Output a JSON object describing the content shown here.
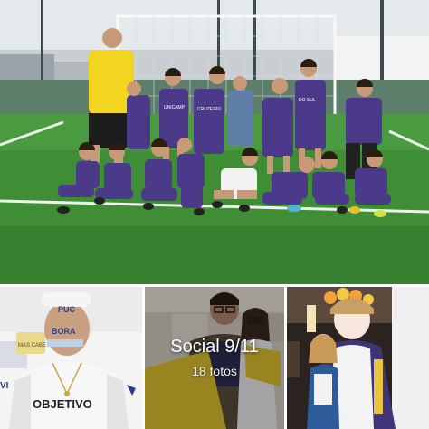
{
  "album": {
    "title": "Social 9/11",
    "count": "18 fotos"
  },
  "photos": {
    "main": {
      "shirt_text_1": "UNICAMP",
      "shirt_text_2": "CRUZEIRO",
      "shirt_text_3": "DO SUL"
    },
    "thumb1": {
      "hat_text": "PUC",
      "face_text": "BORA",
      "shirt_text": "OBJETIVO",
      "sign_text": "MAS CABE",
      "side_text": "VI"
    }
  },
  "colors": {
    "turf": "#3f8e36",
    "uniform": "#4b3a8a",
    "coach_shirt": "#f2d51e",
    "sky": "#e7ecee",
    "overlay": "#000000"
  }
}
